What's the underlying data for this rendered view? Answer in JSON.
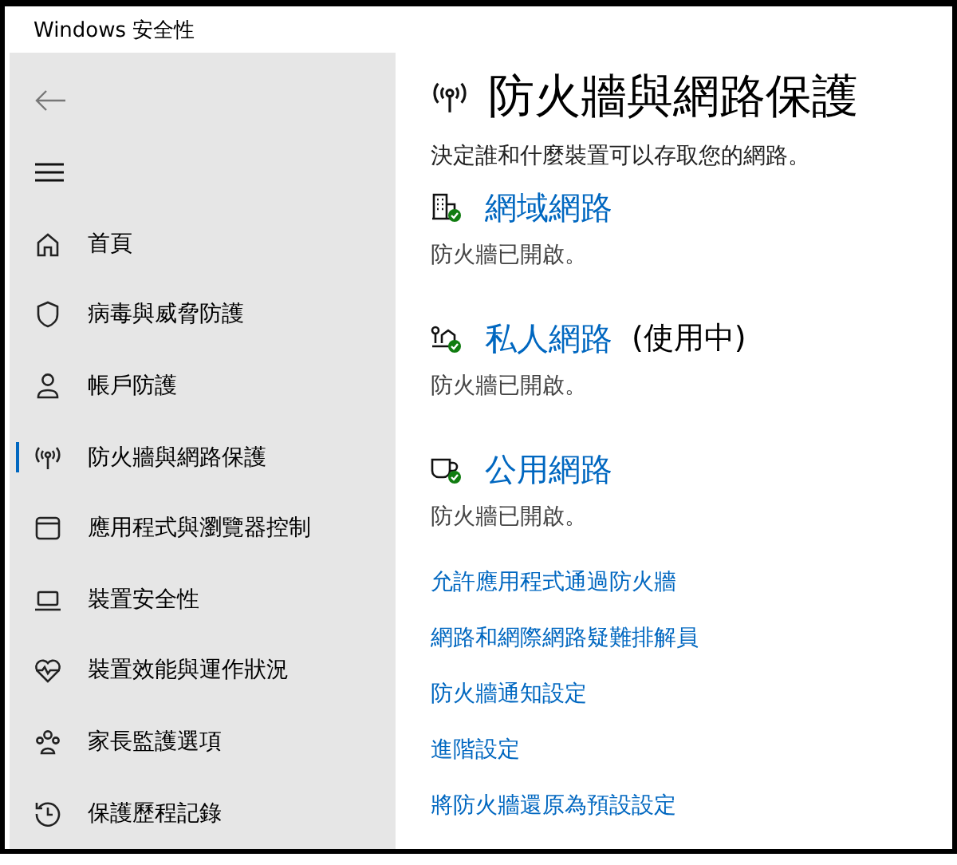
{
  "window": {
    "title": "Windows 安全性"
  },
  "sidebar": {
    "items": [
      {
        "kind": "home",
        "label": "首頁",
        "selected": false
      },
      {
        "kind": "shield",
        "label": "病毒與威脅防護",
        "selected": false
      },
      {
        "kind": "person",
        "label": "帳戶防護",
        "selected": false
      },
      {
        "kind": "antenna",
        "label": "防火牆與網路保護",
        "selected": true
      },
      {
        "kind": "window",
        "label": "應用程式與瀏覽器控制",
        "selected": false
      },
      {
        "kind": "laptop",
        "label": "裝置安全性",
        "selected": false
      },
      {
        "kind": "heart",
        "label": "裝置效能與運作狀況",
        "selected": false
      },
      {
        "kind": "family",
        "label": "家長監護選項",
        "selected": false
      },
      {
        "kind": "history",
        "label": "保護歷程記錄",
        "selected": false
      }
    ]
  },
  "page": {
    "title": "防火牆與網路保護",
    "description": "決定誰和什麼裝置可以存取您的網路。"
  },
  "networks": [
    {
      "kind": "domain",
      "name": "網域網路",
      "status": "防火牆已開啟。"
    },
    {
      "kind": "private",
      "name": "私人網路",
      "active_label": "(使用中)",
      "status": "防火牆已開啟。"
    },
    {
      "kind": "public",
      "name": "公用網路",
      "status": "防火牆已開啟。"
    }
  ],
  "links": [
    "允許應用程式通過防火牆",
    "網路和網際網路疑難排解員",
    "防火牆通知設定",
    "進階設定",
    "將防火牆還原為預設設定"
  ]
}
